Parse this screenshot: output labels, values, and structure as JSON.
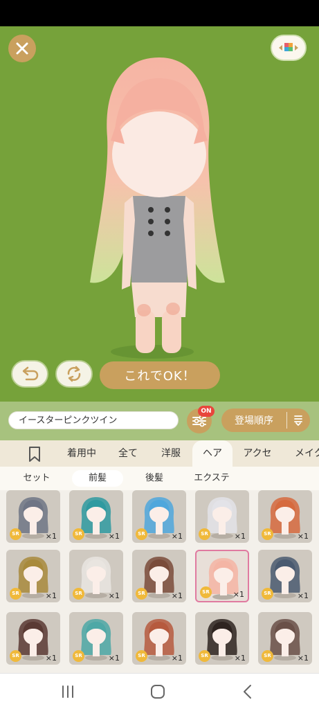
{
  "top_controls": {
    "close_icon": "close-icon",
    "palette_icon": "color-palette-icon"
  },
  "actions": {
    "undo_icon": "undo-icon",
    "refresh_icon": "refresh-icon",
    "ok_label": "これでOK！"
  },
  "search": {
    "value": "イースターピンクツイン",
    "filter_badge": "ON",
    "sort_label": "登場順序"
  },
  "tabs": [
    {
      "label": "着用中"
    },
    {
      "label": "全て"
    },
    {
      "label": "洋服"
    },
    {
      "label": "ヘア",
      "active": true
    },
    {
      "label": "アクセ"
    },
    {
      "label": "メイク"
    }
  ],
  "subtabs": [
    {
      "label": "セット"
    },
    {
      "label": "前髪",
      "active": true
    },
    {
      "label": "後髪"
    },
    {
      "label": "エクステ"
    }
  ],
  "items": [
    {
      "rarity": "SR",
      "count": "×1",
      "color": "#6f7585"
    },
    {
      "rarity": "SR",
      "count": "×1",
      "color": "#2f9aa0"
    },
    {
      "rarity": "SR",
      "count": "×1",
      "color": "#4fa7dc"
    },
    {
      "rarity": "SR",
      "count": "×1",
      "color": "#e3e3e8"
    },
    {
      "rarity": "SR",
      "count": "×1",
      "color": "#d66a3e"
    },
    {
      "rarity": "SR",
      "count": "×1",
      "color": "#a88a3c"
    },
    {
      "rarity": "SR",
      "count": "×1",
      "color": "#e9e5e0"
    },
    {
      "rarity": "SR",
      "count": "×1",
      "color": "#7a4b3a"
    },
    {
      "rarity": "SR",
      "count": "×1",
      "color": "#f4b5a5",
      "selected": true
    },
    {
      "rarity": "SR",
      "count": "×1",
      "color": "#4a5a70"
    },
    {
      "rarity": "SR",
      "count": "×1",
      "color": "#5a3a34"
    },
    {
      "rarity": "SR",
      "count": "×1",
      "color": "#4ea8a6"
    },
    {
      "rarity": "SR",
      "count": "×1",
      "color": "#b65a3e"
    },
    {
      "rarity": "SR",
      "count": "×1",
      "color": "#2e2420"
    },
    {
      "rarity": "SR",
      "count": "×1",
      "color": "#6a5048"
    }
  ],
  "nav": {
    "recents_icon": "recent-apps-icon",
    "home_icon": "home-icon",
    "back_icon": "back-icon"
  },
  "colors": {
    "stage_green": "#76a23a",
    "accent_gold": "#c9a05e",
    "selected_pink": "#e07aa0"
  }
}
